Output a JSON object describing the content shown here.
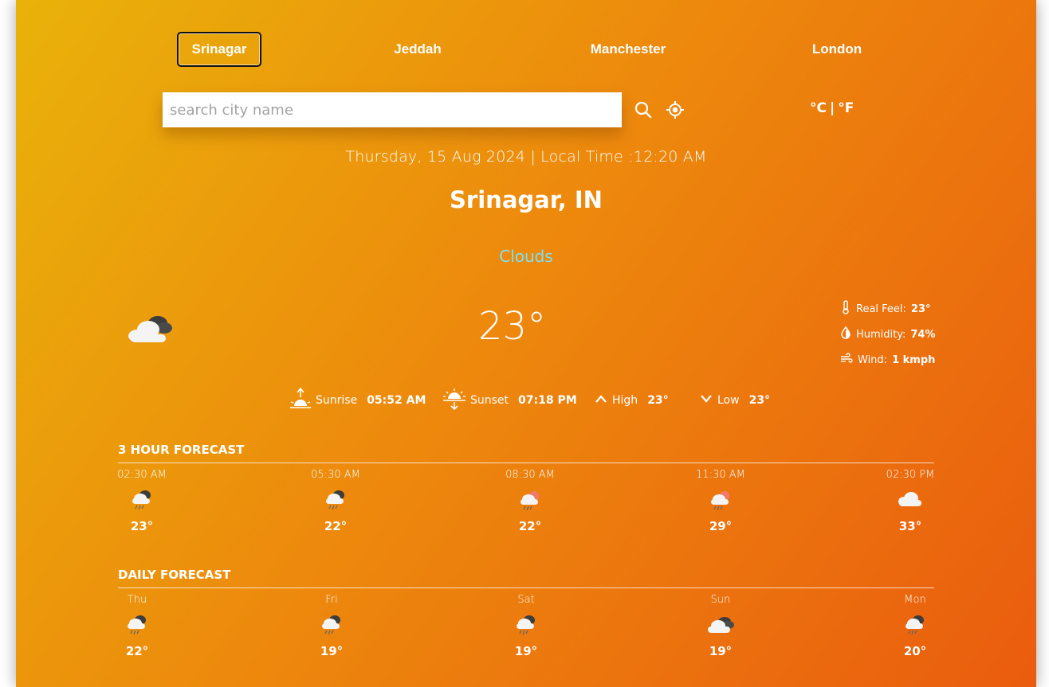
{
  "cities": [
    "Srinagar",
    "Jeddah",
    "Manchester",
    "London"
  ],
  "search": {
    "placeholder": "search city name"
  },
  "units": {
    "celsius": "°C",
    "separator": "|",
    "fahrenheit": "°F"
  },
  "datetime": "Thursday, 15 Aug 2024 | Local Time :12:20 AM",
  "location": "Srinagar, IN",
  "condition": "Clouds",
  "temperature": "23°",
  "details": {
    "real_feel_label": "Real Feel:",
    "real_feel": "23°",
    "humidity_label": "Humidity:",
    "humidity": "74%",
    "wind_label": "Wind:",
    "wind": "1 kmph"
  },
  "sun": {
    "sunrise_label": "Sunrise",
    "sunrise": "05:52 AM",
    "sunset_label": "Sunset",
    "sunset": "07:18 PM",
    "high_label": "High",
    "high": "23°",
    "low_label": "Low",
    "low": "23°"
  },
  "hourly": {
    "title": "3 hour forecast",
    "items": [
      {
        "time": "02:30 AM",
        "temp": "23°",
        "icon": "cloud-rain-icon"
      },
      {
        "time": "05:30 AM",
        "temp": "22°",
        "icon": "cloud-rain-icon"
      },
      {
        "time": "08:30 AM",
        "temp": "22°",
        "icon": "cloud-sun-rain-icon"
      },
      {
        "time": "11:30 AM",
        "temp": "29°",
        "icon": "cloud-sun-rain-icon"
      },
      {
        "time": "02:30 PM",
        "temp": "33°",
        "icon": "cloud-icon"
      }
    ]
  },
  "daily": {
    "title": "daily forecast",
    "items": [
      {
        "day": "Thu",
        "temp": "22°",
        "icon": "cloud-rain-icon"
      },
      {
        "day": "Fri",
        "temp": "19°",
        "icon": "cloud-rain-icon"
      },
      {
        "day": "Sat",
        "temp": "19°",
        "icon": "cloud-rain-icon"
      },
      {
        "day": "Sun",
        "temp": "19°",
        "icon": "clouds-icon"
      },
      {
        "day": "Mon",
        "temp": "20°",
        "icon": "cloud-rain-icon"
      }
    ]
  },
  "colors": {
    "gradient_start": "#e9b20a",
    "gradient_end": "#ea5c0e",
    "condition": "#7fe0f0"
  }
}
